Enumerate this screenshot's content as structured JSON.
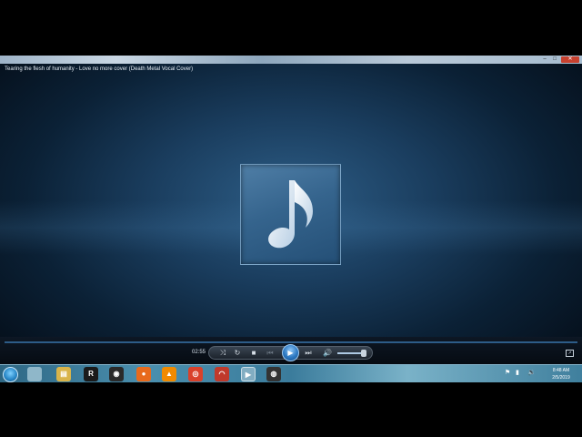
{
  "window": {
    "title": "",
    "buttons": {
      "minimize": "–",
      "maximize": "□",
      "close": "✕"
    }
  },
  "player": {
    "now_playing": "Tearing the flesh of humanity - Love no more cover (Death Metal Vocal Cover)",
    "album_art_icon": "music-note-icon",
    "progress_fraction": 0.0
  },
  "controls": {
    "elapsed_time": "02:55",
    "shuffle": "⤨",
    "repeat": "↻",
    "stop": "■",
    "previous": "⏮",
    "play": "▶",
    "next": "⏭",
    "mute": "🔊",
    "volume_fraction": 0.85,
    "switch_view": "↗"
  },
  "taskbar": {
    "apps": [
      {
        "name": "file-explorer",
        "glyph": "▤",
        "color": "#d9b44a"
      },
      {
        "name": "app-r",
        "glyph": "R",
        "color": "#1a1a1a"
      },
      {
        "name": "app-circle",
        "glyph": "◉",
        "color": "#2a2a2a"
      },
      {
        "name": "firefox",
        "glyph": "●",
        "color": "#e86a1c"
      },
      {
        "name": "vlc",
        "glyph": "▲",
        "color": "#f08a00"
      },
      {
        "name": "chrome",
        "glyph": "◎",
        "color": "#d9412b"
      },
      {
        "name": "headphones-app",
        "glyph": "◠",
        "color": "#c0392b"
      },
      {
        "name": "media-player",
        "glyph": "▶",
        "color": "#e67e22"
      },
      {
        "name": "obs",
        "glyph": "◍",
        "color": "#333"
      }
    ],
    "tray": {
      "flag": "⚑",
      "network": "▮",
      "volume": "🔉"
    },
    "clock_time": "8:48 AM",
    "clock_date": "2/5/2019"
  }
}
